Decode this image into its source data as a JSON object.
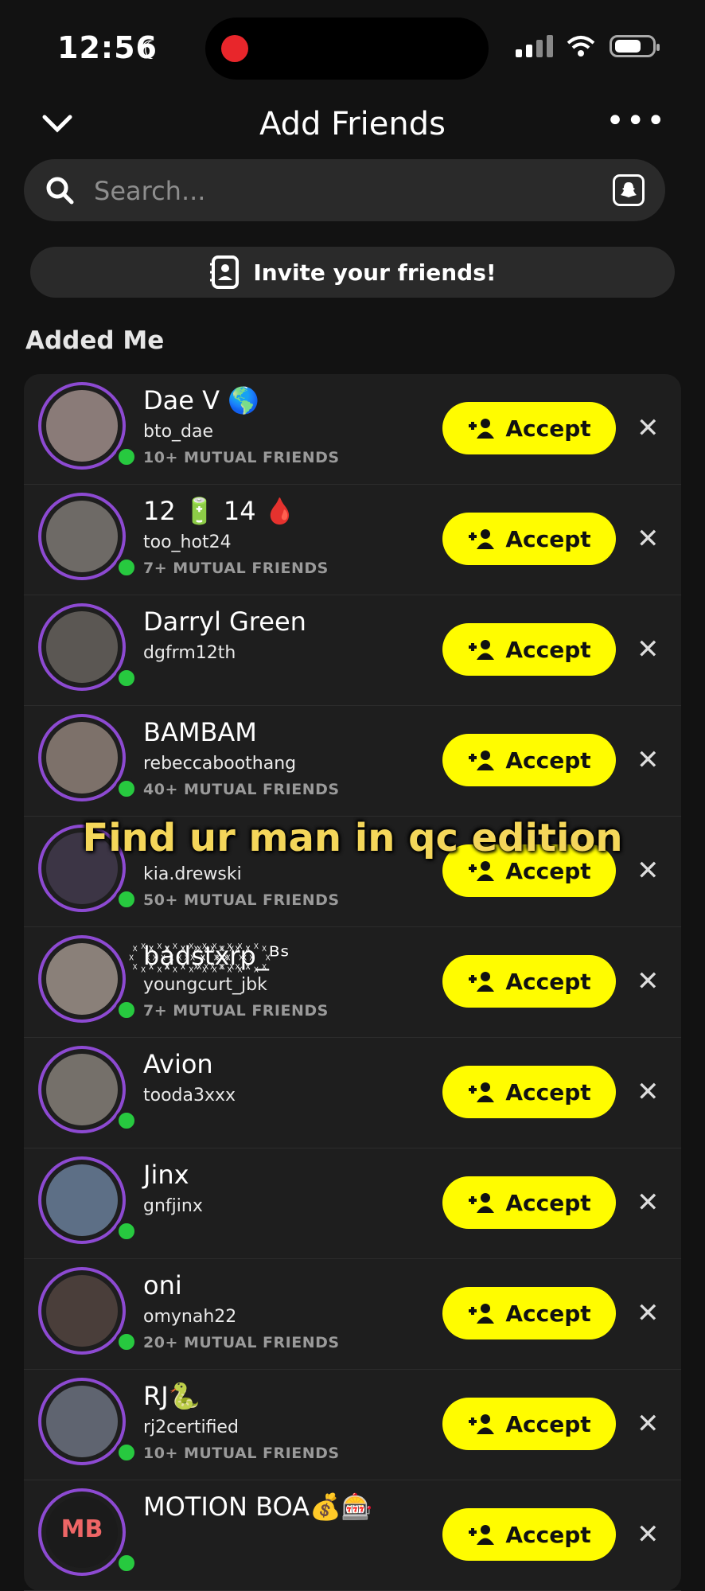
{
  "status": {
    "time": "12:56",
    "moon_icon": "moon-icon",
    "battery_icon": "battery-icon"
  },
  "header": {
    "title": "Add Friends",
    "back_icon": "chevron-down-icon",
    "more_label": "•••"
  },
  "search": {
    "placeholder": "Search..."
  },
  "invite": {
    "label": "Invite your friends!"
  },
  "section": {
    "title": "Added Me"
  },
  "accept_label": "Accept",
  "dismiss_label": "✕",
  "rows": [
    {
      "name": "Dae V 🌎",
      "username": "bto_dae",
      "mutual": "10+ MUTUAL FRIENDS",
      "avatar_color": "#8a7b78"
    },
    {
      "name": "12 🔋 14 🩸",
      "username": "too_hot24",
      "mutual": "7+ MUTUAL FRIENDS",
      "avatar_color": "#6e6a66"
    },
    {
      "name": "Darryl Green",
      "username": "dgfrm12th",
      "mutual": "",
      "avatar_color": "#5b5753"
    },
    {
      "name": "BAMBAM",
      "username": "rebeccaboothang",
      "mutual": "40+ MUTUAL FRIENDS",
      "avatar_color": "#7d716a"
    },
    {
      "name": "",
      "username": "kia.drewski",
      "mutual": "50+ MUTUAL FRIENDS",
      "avatar_color": "#3c3545"
    },
    {
      "name": "꙰b꙰a꙰d꙰s꙰t꙰x꙰r꙰p꙰_ᴮˢ",
      "username": "youngcurt_jbk",
      "mutual": "7+ MUTUAL FRIENDS",
      "avatar_color": "#8a8079"
    },
    {
      "name": "Avion",
      "username": "tooda3xxx",
      "mutual": "",
      "avatar_color": "#75706a"
    },
    {
      "name": "Jinx",
      "username": "gnfjinx",
      "mutual": "",
      "avatar_color": "#5d6f86"
    },
    {
      "name": "oni",
      "username": "omynah22",
      "mutual": "20+ MUTUAL FRIENDS",
      "avatar_color": "#4a3e3a"
    },
    {
      "name": "RJ🐍",
      "username": "rj2certified",
      "mutual": "10+ MUTUAL FRIENDS",
      "avatar_color": "#5f6470"
    },
    {
      "name": "MOTION BOA💰🎰",
      "username": "",
      "mutual": "",
      "avatar_color": "#1b1b1b",
      "initials": "MB"
    }
  ],
  "overlay_text": "Find ur man in qc edition"
}
